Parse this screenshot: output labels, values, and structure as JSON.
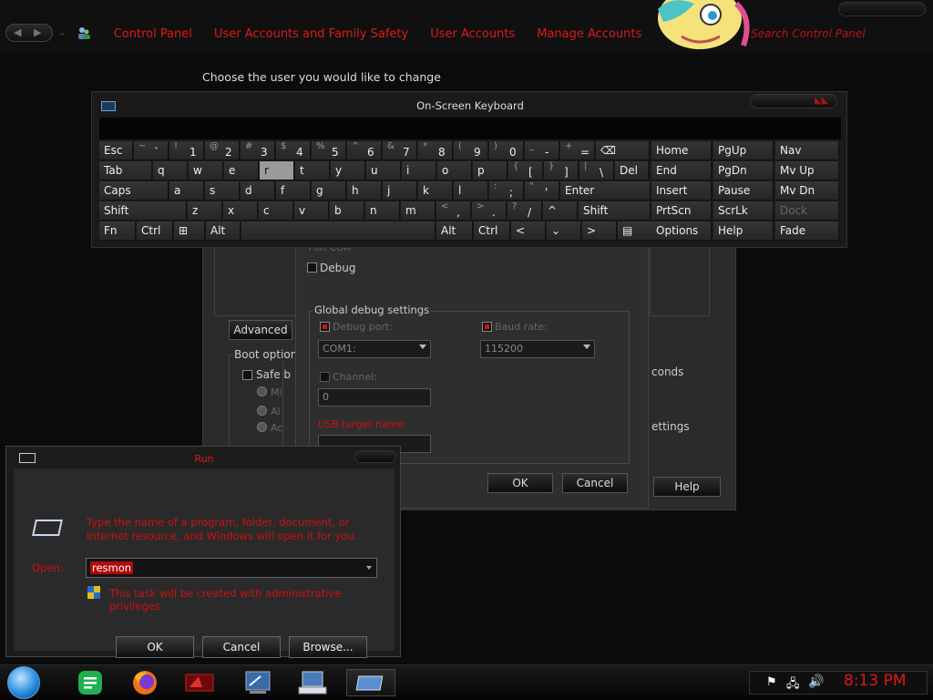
{
  "control_panel": {
    "breadcrumbs": [
      "Control Panel",
      "User Accounts and Family Safety",
      "User Accounts",
      "Manage Accounts"
    ],
    "search_placeholder": "Search Control Panel"
  },
  "page": {
    "heading": "Choose the user you would like to change"
  },
  "back_dialog": {
    "advanced_button": "Advanced",
    "boot_options_label": "Boot option",
    "safe_boot_label": "Safe b",
    "radio_labels": [
      "Mi",
      "Al",
      "Ac"
    ],
    "seconds_text": "conds",
    "settings_text": "ettings",
    "help_button": "Help"
  },
  "debug_dialog": {
    "partial_top_text": "Port COM",
    "debug_checkbox": "Debug",
    "global_group_title": "Global debug settings",
    "debug_port_label": "Debug port:",
    "debug_port_value": "COM1:",
    "baud_rate_label": "Baud rate:",
    "baud_rate_value": "115200",
    "channel_label": "Channel:",
    "channel_value": "0",
    "usb_target_label": "USB target name:",
    "ok_button": "OK",
    "cancel_button": "Cancel"
  },
  "osk": {
    "title": "On-Screen Keyboard",
    "rows": [
      [
        {
          "k": "Esc"
        },
        {
          "s": "~",
          "m": "`"
        },
        {
          "s": "!",
          "m": "1"
        },
        {
          "s": "@",
          "m": "2"
        },
        {
          "s": "#",
          "m": "3"
        },
        {
          "s": "$",
          "m": "4"
        },
        {
          "s": "%",
          "m": "5"
        },
        {
          "s": "^",
          "m": "6"
        },
        {
          "s": "&",
          "m": "7"
        },
        {
          "s": "*",
          "m": "8"
        },
        {
          "s": "(",
          "m": "9"
        },
        {
          "s": ")",
          "m": "0"
        },
        {
          "s": "_",
          "m": "-"
        },
        {
          "s": "+",
          "m": "="
        },
        {
          "k": "⌫"
        }
      ],
      [
        {
          "k": "Tab"
        },
        {
          "k": "q"
        },
        {
          "k": "w"
        },
        {
          "k": "e"
        },
        {
          "k": "r",
          "hl": true
        },
        {
          "k": "t"
        },
        {
          "k": "y"
        },
        {
          "k": "u"
        },
        {
          "k": "i"
        },
        {
          "k": "o"
        },
        {
          "k": "p"
        },
        {
          "s": "{",
          "m": "["
        },
        {
          "s": "}",
          "m": "]"
        },
        {
          "s": "|",
          "m": "\\"
        },
        {
          "k": "Del"
        }
      ],
      [
        {
          "k": "Caps"
        },
        {
          "k": "a"
        },
        {
          "k": "s"
        },
        {
          "k": "d"
        },
        {
          "k": "f"
        },
        {
          "k": "g"
        },
        {
          "k": "h"
        },
        {
          "k": "j"
        },
        {
          "k": "k"
        },
        {
          "k": "l"
        },
        {
          "s": ":",
          "m": ";"
        },
        {
          "s": "\"",
          "m": "'"
        },
        {
          "k": "Enter"
        }
      ],
      [
        {
          "k": "Shift"
        },
        {
          "k": "z"
        },
        {
          "k": "x"
        },
        {
          "k": "c"
        },
        {
          "k": "v"
        },
        {
          "k": "b"
        },
        {
          "k": "n"
        },
        {
          "k": "m"
        },
        {
          "s": "<",
          "m": ","
        },
        {
          "s": ">",
          "m": "."
        },
        {
          "s": "?",
          "m": "/"
        },
        {
          "k": "^"
        },
        {
          "k": "Shift"
        }
      ],
      [
        {
          "k": "Fn"
        },
        {
          "k": "Ctrl"
        },
        {
          "k": "⊞"
        },
        {
          "k": "Alt"
        },
        {
          "k": ""
        },
        {
          "k": "Alt"
        },
        {
          "k": "Ctrl"
        },
        {
          "k": "<"
        },
        {
          "k": "⌄"
        },
        {
          "k": ">"
        },
        {
          "k": "▤"
        }
      ]
    ],
    "nav_rows": [
      [
        "Home",
        "PgUp",
        "Nav"
      ],
      [
        "End",
        "PgDn",
        "Mv Up"
      ],
      [
        "Insert",
        "Pause",
        "Mv Dn"
      ],
      [
        "PrtScn",
        "ScrLk",
        "Dock"
      ],
      [
        "Options",
        "Help",
        "Fade"
      ]
    ]
  },
  "run_dialog": {
    "title": "Run",
    "description": "Type the name of a program, folder, document, or Internet resource, and Windows will open it for you.",
    "open_label": "Open:",
    "open_value": "resmon",
    "admin_note": "This task will be created with administrative privileges.",
    "ok_button": "OK",
    "cancel_button": "Cancel",
    "browse_button": "Browse..."
  },
  "taskbar": {
    "clock": "8:13 PM",
    "accent": "#e01818"
  }
}
